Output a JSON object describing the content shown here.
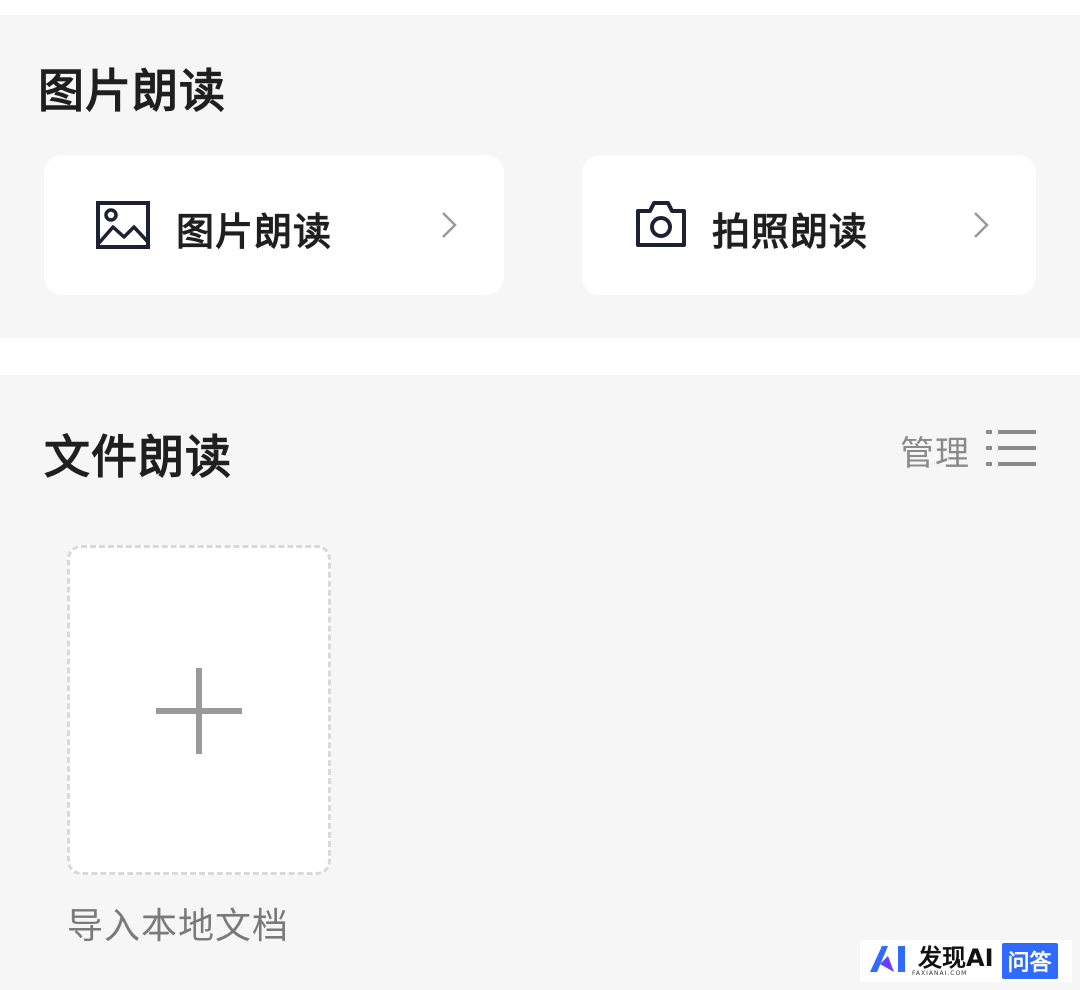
{
  "image_section": {
    "title": "图片朗读",
    "cards": [
      {
        "label": "图片朗读",
        "icon": "image-icon"
      },
      {
        "label": "拍照朗读",
        "icon": "camera-icon"
      }
    ]
  },
  "file_section": {
    "title": "文件朗读",
    "manage_label": "管理",
    "manage_icon": "list-icon",
    "import_icon": "plus-icon",
    "import_label": "导入本地文档"
  },
  "watermark": {
    "brand": "发现AI",
    "sub": "FAXIANAI.COM",
    "badge": "问答"
  },
  "colors": {
    "background": "#f6f6f6",
    "card": "#ffffff",
    "text": "#1f1f1f",
    "muted": "#8a8a8a",
    "icon_dark": "#1c2233",
    "accent": "#2f6bff"
  }
}
